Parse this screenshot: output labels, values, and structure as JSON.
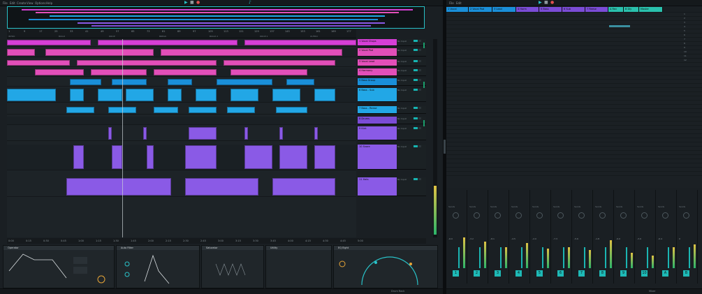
{
  "left": {
    "menu": [
      "File",
      "Edit",
      "Create",
      "View",
      "Options",
      "Help"
    ],
    "ruler_marks": [
      "1",
      "9",
      "17",
      "25",
      "33",
      "41",
      "49",
      "57",
      "65",
      "73",
      "81",
      "89",
      "97",
      "105",
      "113",
      "121",
      "129",
      "137",
      "145",
      "153",
      "161",
      "169",
      "177"
    ],
    "time_marks": [
      "0:00",
      "0:15",
      "0:30",
      "0:45",
      "1:00",
      "1:15",
      "1:30",
      "1:45",
      "2:00",
      "2:15",
      "2:30",
      "2:45",
      "3:00",
      "3:15",
      "3:30",
      "3:45",
      "4:00",
      "4:15",
      "4:30",
      "4:45",
      "5:00"
    ],
    "locators": [
      "INTRO",
      "BUILD",
      "DROP",
      "BREAK",
      "BUILD 2",
      "DROP 2",
      "OUTRO"
    ],
    "tracks": [
      {
        "name": "1 Vocal Chops",
        "color": "#d63fd6"
      },
      {
        "name": "2 Vocal Pad",
        "color": "#e24fb9"
      },
      {
        "name": "3 Vocal Lead",
        "color": "#e24fb9"
      },
      {
        "name": "4 Harmony",
        "color": "#e24fb9"
      },
      {
        "name": "5 Bass Group",
        "color": "#1a8fd9"
      },
      {
        "name": "6 Bass - Sub",
        "color": "#22a7e6"
      },
      {
        "name": "7 Bass - Reese",
        "color": "#22a7e6"
      },
      {
        "name": "8 Drums",
        "color": "#7b4cd6"
      },
      {
        "name": "9 Kick",
        "color": "#8a5ae6"
      },
      {
        "name": "10 Snare",
        "color": "#8a5ae6"
      },
      {
        "name": "11 Hats",
        "color": "#8a5ae6"
      }
    ],
    "io_label": "No Input",
    "devices": [
      "Operator",
      "Auto Filter",
      "Saturator",
      "Utility",
      "EQ Eight"
    ],
    "status": "Drum Rack"
  },
  "right": {
    "headers": [
      {
        "name": "1 Vocal",
        "color": "#1a8fd9"
      },
      {
        "name": "2 Vocal Pad",
        "color": "#1a8fd9"
      },
      {
        "name": "3 Lead",
        "color": "#1a8fd9"
      },
      {
        "name": "4 Harm",
        "color": "#7b4cd6"
      },
      {
        "name": "5 Bass",
        "color": "#7b4cd6"
      },
      {
        "name": "6 Sub",
        "color": "#7b4cd6"
      },
      {
        "name": "7 Reese",
        "color": "#7b4cd6"
      },
      {
        "name": "A Rev",
        "color": "#2ac1ad"
      },
      {
        "name": "B Dly",
        "color": "#2ac1ad"
      },
      {
        "name": "Master",
        "color": "#2ac1ad"
      }
    ],
    "scenes": [
      "1",
      "2",
      "3",
      "4",
      "5",
      "6",
      "7",
      "8",
      "9",
      "10",
      "11",
      "12"
    ],
    "strip_numbers": [
      "1",
      "2",
      "3",
      "4",
      "5",
      "6",
      "7",
      "8",
      "9",
      "10",
      "A",
      "B"
    ],
    "send_label": "Sends",
    "vol_values": [
      "-6.0",
      "-3.2",
      "-8.1",
      "-4.5",
      "-2.0",
      "-7.3",
      "-5.6",
      "-1.8",
      "-9.0",
      "-3.9",
      "-6.4",
      "0"
    ],
    "status": "Mixer"
  }
}
